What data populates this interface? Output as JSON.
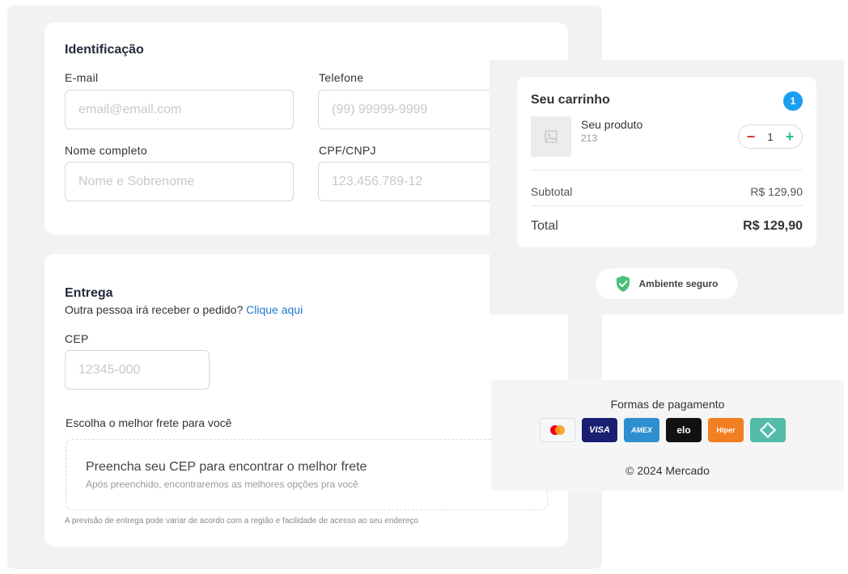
{
  "identificacao": {
    "title": "Identificação",
    "email": {
      "label": "E-mail",
      "placeholder": "email@email.com",
      "value": ""
    },
    "telefone": {
      "label": "Telefone",
      "placeholder": "(99) 99999-9999",
      "value": ""
    },
    "nome": {
      "label": "Nome completo",
      "placeholder": "Nome e Sobrenome",
      "value": ""
    },
    "cpf": {
      "label": "CPF/CNPJ",
      "placeholder": "123.456.789-12",
      "value": ""
    }
  },
  "entrega": {
    "title": "Entrega",
    "outra_pessoa_text": "Outra pessoa irá receber o pedido?",
    "outra_pessoa_link": "Clique aqui",
    "cep": {
      "label": "CEP",
      "placeholder": "12345-000",
      "value": ""
    },
    "frete_label": "Escolha o melhor frete para você",
    "frete_box_title": "Preencha seu CEP para encontrar o melhor frete",
    "frete_box_sub": "Após preenchido, encontraremos as melhores opções pra você",
    "note": "A previsão de entrega pode variar de acordo com a região e facilidade de acesso ao seu endereço"
  },
  "cart": {
    "title": "Seu carrinho",
    "count": "1",
    "product": {
      "name": "Seu produto",
      "sku": "213",
      "qty": "1"
    },
    "minus": "−",
    "plus": "+",
    "subtotal_label": "Subtotal",
    "subtotal_value": "R$ 129,90",
    "total_label": "Total",
    "total_value": "R$ 129,90"
  },
  "secure": {
    "label": "Ambiente seguro",
    "icon": "shield-check-icon",
    "color": "#4cc07b"
  },
  "payment": {
    "title": "Formas de pagamento",
    "methods": [
      {
        "name": "mastercard",
        "label": "",
        "bg": "#f7f7f7"
      },
      {
        "name": "visa",
        "label": "VISA",
        "bg": "#1a1f71"
      },
      {
        "name": "amex",
        "label": "AMEX",
        "bg": "#2d8fd0"
      },
      {
        "name": "elo",
        "label": "elo",
        "bg": "#111111"
      },
      {
        "name": "hiper",
        "label": "Hiper",
        "bg": "#f27f21"
      },
      {
        "name": "pix",
        "label": "",
        "bg": "#52bca8"
      }
    ]
  },
  "footer": {
    "copyright": "© 2024 Mercado"
  },
  "colors": {
    "accent": "#1a9ff0",
    "link": "#1f77d0",
    "minus": "#e03131",
    "plus": "#2fbf8f"
  }
}
